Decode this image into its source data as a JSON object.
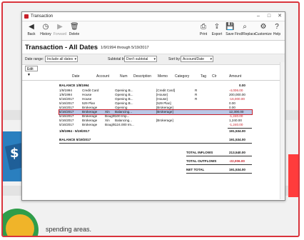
{
  "window": {
    "title": "Transaction"
  },
  "toolbar": {
    "back": "Back",
    "history": "History",
    "forward": "Forward",
    "delete": "Delete",
    "print": "Print",
    "export": "Export",
    "save": "Save",
    "find_replace": "Find/Replace",
    "customize": "Customize",
    "help": "Help"
  },
  "report": {
    "title": "Transaction - All Dates",
    "range": "1/9/1994 through 5/19/2017"
  },
  "filters": {
    "date_range_label": "Date range:",
    "date_range_value": "Include all dates",
    "subtotal_label": "Subtotal by:",
    "subtotal_value": "Don't subtotal",
    "sort_label": "Sort by:",
    "sort_value": "Account/Date"
  },
  "edit_label": "Edit ▼",
  "columns": [
    "Date",
    "Account",
    "Num",
    "Description",
    "Memo",
    "Category",
    "Tag",
    "Clr",
    "Amount"
  ],
  "balance_start": {
    "label": "BALANCE 1/8/1994",
    "amount": "0.00"
  },
  "rows": [
    {
      "date": "1/9/1994",
      "account": "Credit Card",
      "num": "",
      "desc": "Opening B...",
      "cat": "[Credit Card]",
      "clr": "R",
      "amount": "-4,006.00",
      "neg": true
    },
    {
      "date": "1/9/1994",
      "account": "House",
      "num": "",
      "desc": "Opening B...",
      "cat": "[House]",
      "clr": "R",
      "amount": "200,000.00",
      "neg": false
    },
    {
      "date": "5/16/2017",
      "account": "House",
      "num": "",
      "desc": "Opening B...",
      "cat": "[House]",
      "clr": "R",
      "amount": "-16,000.00",
      "neg": true
    },
    {
      "date": "5/16/2017",
      "account": "529 Plan",
      "num": "",
      "desc": "Opening B...",
      "cat": "[529 Plan]",
      "clr": "",
      "amount": "0.00",
      "neg": false
    },
    {
      "date": "5/16/2017",
      "account": "Brokerage",
      "num": "",
      "desc": "Opening",
      "cat": "[Brokerage]",
      "clr": "",
      "amount": "0.00",
      "neg": false
    },
    {
      "date": "5/16/2017",
      "account": "Brokerage",
      "num": "Xin",
      "desc": "Balancing...",
      "cat": "[Brokerage]",
      "clr": "",
      "amount": "12,300.00",
      "neg": false,
      "selected": true
    },
    {
      "date": "5/16/2017",
      "account": "Brokerage",
      "num": "Bought",
      "desc": "100 Imp...",
      "cat": "",
      "clr": "",
      "amount": "-1,240.00",
      "neg": true
    },
    {
      "date": "5/16/2017",
      "account": "Brokerage",
      "num": "Xin",
      "desc": "Balancing...",
      "cat": "[Brokerage]",
      "clr": "",
      "amount": "1,240.00",
      "neg": false
    },
    {
      "date": "5/16/2017",
      "account": "Brokerage",
      "num": "Bought",
      "desc": "124.000 Im...",
      "cat": "",
      "clr": "",
      "amount": "-1,240.00",
      "neg": true
    }
  ],
  "subtotal": {
    "label": "1/9/1994 - 5/19/2017",
    "amount": "191,534.00"
  },
  "balance_end": {
    "label": "BALANCE 5/19/2017",
    "amount": "191,534.00"
  },
  "totals": [
    {
      "label": "TOTAL INFLOWS",
      "amount": "213,540.00",
      "neg": false
    },
    {
      "label": "TOTAL OUTFLOWS",
      "amount": "-22,006.00",
      "neg": true
    },
    {
      "label": "NET TOTAL",
      "amount": "191,534.00",
      "neg": false
    }
  ],
  "background": {
    "footer_text": "spending areas."
  },
  "colors": {
    "frame": "#d9343c",
    "selection": "#b9c7e6",
    "negative": "#c8202a"
  }
}
